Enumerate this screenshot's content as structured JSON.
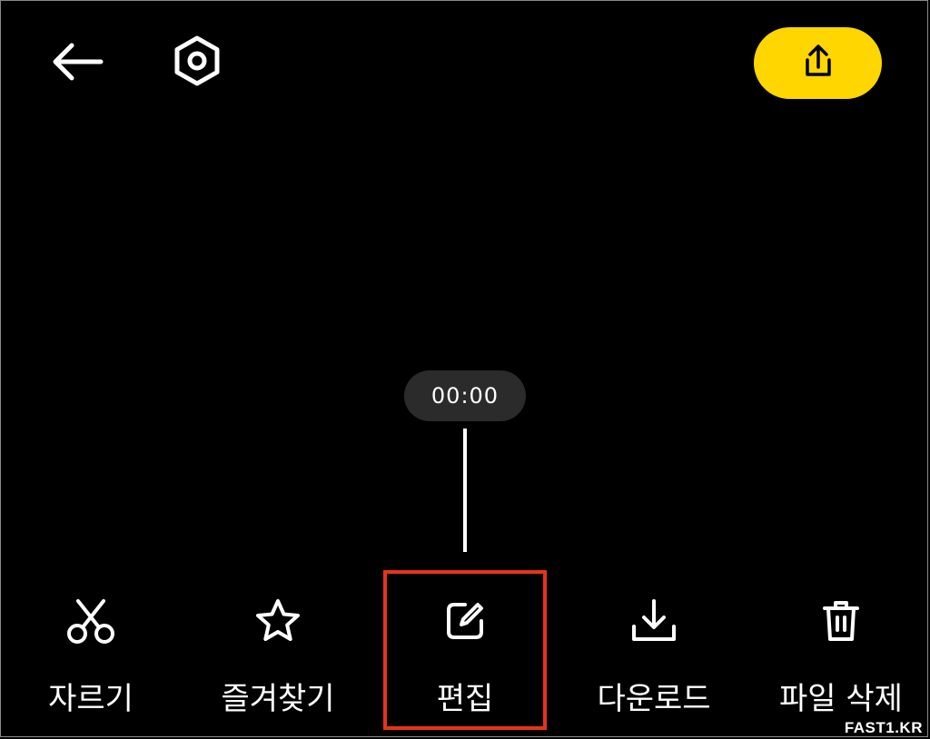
{
  "header": {
    "back_icon": "arrow-left-icon",
    "settings_icon": "hexagon-settings-icon",
    "share_icon": "share-upload-icon",
    "share_color": "#ffd600"
  },
  "timeline": {
    "current_time": "00:00"
  },
  "toolbar": {
    "items": [
      {
        "label": "자르기",
        "icon": "scissors-icon"
      },
      {
        "label": "즐겨찾기",
        "icon": "star-icon"
      },
      {
        "label": "편집",
        "icon": "edit-icon",
        "highlighted": true
      },
      {
        "label": "다운로드",
        "icon": "download-icon"
      },
      {
        "label": "파일 삭제",
        "icon": "trash-icon"
      }
    ],
    "highlight_color": "#e8321e"
  },
  "watermark": "FAST1.KR"
}
